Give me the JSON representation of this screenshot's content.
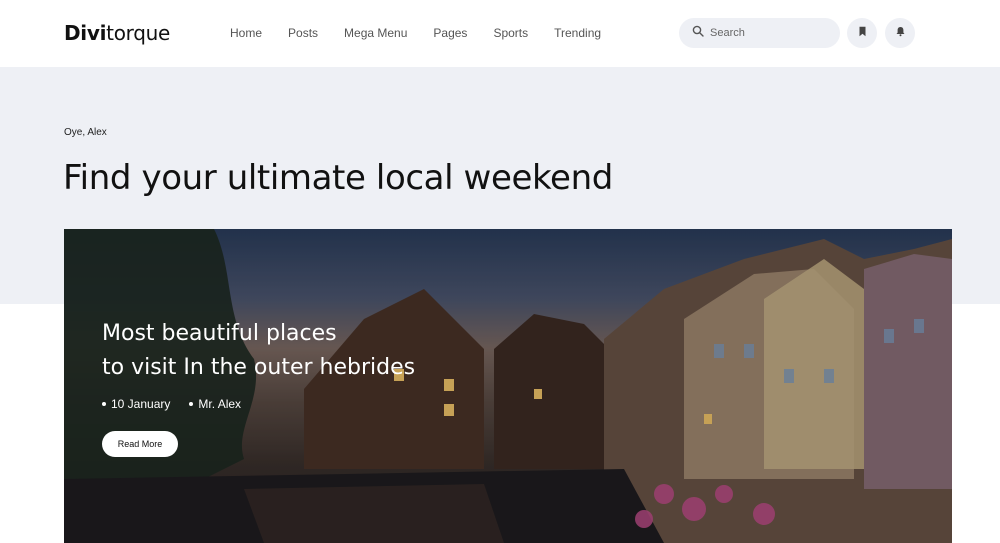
{
  "brand": {
    "logo_bold": "Divi",
    "logo_light": "torque"
  },
  "nav": {
    "items": [
      {
        "label": "Home"
      },
      {
        "label": "Posts"
      },
      {
        "label": "Mega Menu"
      },
      {
        "label": "Pages"
      },
      {
        "label": "Sports"
      },
      {
        "label": "Trending"
      }
    ]
  },
  "search": {
    "placeholder": "Search",
    "icon": "search-icon"
  },
  "header_actions": {
    "bookmark_icon": "bookmark-icon",
    "bell_icon": "bell-icon"
  },
  "hero": {
    "greeting": "Oye, Alex",
    "headline": "Find your ultimate local weekend"
  },
  "feature": {
    "title_line1": "Most beautiful places",
    "title_line2": "to visit In the outer hebrides",
    "date": "10 January",
    "author": "Mr. Alex",
    "cta_label": "Read More"
  },
  "colors": {
    "band_bg": "#eef0f5",
    "text_dark": "#111111",
    "nav_text": "#555555"
  }
}
